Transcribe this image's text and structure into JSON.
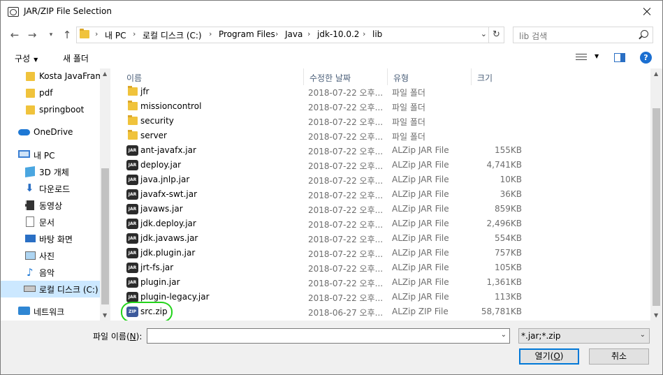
{
  "window": {
    "title": "JAR/ZIP File Selection"
  },
  "address": {
    "crumbs": [
      "내 PC",
      "로컬 디스크 (C:)",
      "Program Files",
      "Java",
      "jdk-10.0.2",
      "lib"
    ]
  },
  "search": {
    "placeholder": "lib 검색"
  },
  "commands": {
    "organize": "구성",
    "new_folder": "새 폴더",
    "help": "?"
  },
  "nav": {
    "items": [
      {
        "label": "Kosta JavaFrame"
      },
      {
        "label": "pdf"
      },
      {
        "label": "springboot"
      },
      {
        "label": "OneDrive"
      },
      {
        "label": "내 PC"
      },
      {
        "label": "3D 개체"
      },
      {
        "label": "다운로드"
      },
      {
        "label": "동영상"
      },
      {
        "label": "문서"
      },
      {
        "label": "바탕 화면"
      },
      {
        "label": "사진"
      },
      {
        "label": "음악"
      },
      {
        "label": "로컬 디스크 (C:)"
      },
      {
        "label": "네트워크"
      }
    ]
  },
  "columns": {
    "name": "이름",
    "date": "수정한 날짜",
    "type": "유형",
    "size": "크기"
  },
  "files": [
    {
      "name": "jfr",
      "date": "2018-07-22 오후...",
      "type": "파일 폴더",
      "size": "",
      "icon": "folder"
    },
    {
      "name": "missioncontrol",
      "date": "2018-07-22 오후...",
      "type": "파일 폴더",
      "size": "",
      "icon": "folder"
    },
    {
      "name": "security",
      "date": "2018-07-22 오후...",
      "type": "파일 폴더",
      "size": "",
      "icon": "folder"
    },
    {
      "name": "server",
      "date": "2018-07-22 오후...",
      "type": "파일 폴더",
      "size": "",
      "icon": "folder"
    },
    {
      "name": "ant-javafx.jar",
      "date": "2018-07-22 오후...",
      "type": "ALZip JAR File",
      "size": "155KB",
      "icon": "jar"
    },
    {
      "name": "deploy.jar",
      "date": "2018-07-22 오후...",
      "type": "ALZip JAR File",
      "size": "4,741KB",
      "icon": "jar"
    },
    {
      "name": "java.jnlp.jar",
      "date": "2018-07-22 오후...",
      "type": "ALZip JAR File",
      "size": "10KB",
      "icon": "jar"
    },
    {
      "name": "javafx-swt.jar",
      "date": "2018-07-22 오후...",
      "type": "ALZip JAR File",
      "size": "36KB",
      "icon": "jar"
    },
    {
      "name": "javaws.jar",
      "date": "2018-07-22 오후...",
      "type": "ALZip JAR File",
      "size": "859KB",
      "icon": "jar"
    },
    {
      "name": "jdk.deploy.jar",
      "date": "2018-07-22 오후...",
      "type": "ALZip JAR File",
      "size": "2,496KB",
      "icon": "jar"
    },
    {
      "name": "jdk.javaws.jar",
      "date": "2018-07-22 오후...",
      "type": "ALZip JAR File",
      "size": "554KB",
      "icon": "jar"
    },
    {
      "name": "jdk.plugin.jar",
      "date": "2018-07-22 오후...",
      "type": "ALZip JAR File",
      "size": "757KB",
      "icon": "jar"
    },
    {
      "name": "jrt-fs.jar",
      "date": "2018-07-22 오후...",
      "type": "ALZip JAR File",
      "size": "105KB",
      "icon": "jar"
    },
    {
      "name": "plugin.jar",
      "date": "2018-07-22 오후...",
      "type": "ALZip JAR File",
      "size": "1,361KB",
      "icon": "jar"
    },
    {
      "name": "plugin-legacy.jar",
      "date": "2018-07-22 오후...",
      "type": "ALZip JAR File",
      "size": "113KB",
      "icon": "jar"
    },
    {
      "name": "src.zip",
      "date": "2018-06-27 오후...",
      "type": "ALZip ZIP File",
      "size": "58,781KB",
      "icon": "zip"
    }
  ],
  "bottom": {
    "filename_label": "파일 이름(",
    "filename_key": "N",
    "filename_suffix": "):",
    "filename_value": "",
    "filter_value": "*.jar;*.zip",
    "open_label": "열기(",
    "open_key": "O",
    "open_suffix": ")",
    "cancel_label": "취소"
  },
  "icon_text": {
    "jar": "JAR",
    "zip": "ZIP"
  },
  "colors": {
    "accent": "#0078d7",
    "selected_nav": "#cce8ff",
    "annotation": "#22d41a"
  }
}
